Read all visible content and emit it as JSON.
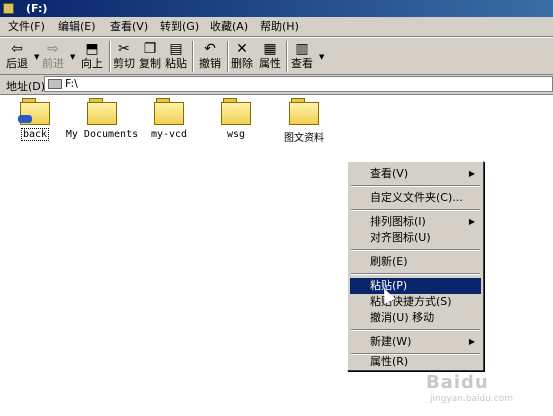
{
  "window": {
    "title": "(F:)"
  },
  "menu": [
    "文件(F)",
    "编辑(E)",
    "查看(V)",
    "转到(G)",
    "收藏(A)",
    "帮助(H)"
  ],
  "toolbar": {
    "back": "后退",
    "forward": "前进",
    "up": "向上",
    "cut": "剪切",
    "copy": "复制",
    "paste": "粘贴",
    "undo": "撤销",
    "delete": "删除",
    "properties": "属性",
    "view": "查看"
  },
  "address": {
    "label": "地址(D)",
    "value": "F:\\"
  },
  "folders": [
    "back",
    "My Documents",
    "my-vcd",
    "wsg",
    "图文资料"
  ],
  "context_menu": {
    "view": "查看(V)",
    "customize": "自定义文件夹(C)...",
    "arrange": "排列图标(I)",
    "line_up": "对齐图标(U)",
    "refresh": "刷新(E)",
    "paste": "粘贴(P)",
    "paste_shortcut": "粘贴快捷方式(S)",
    "undo_move": "撤消(U) 移动",
    "new": "新建(W)",
    "properties": "属性(R)"
  },
  "watermark": {
    "brand": "Baidu",
    "sub": "jingyan.baidu.com"
  },
  "colors": {
    "titlebar": "#0a246a",
    "highlight": "#0a246a",
    "chrome": "#d4d0c8"
  }
}
